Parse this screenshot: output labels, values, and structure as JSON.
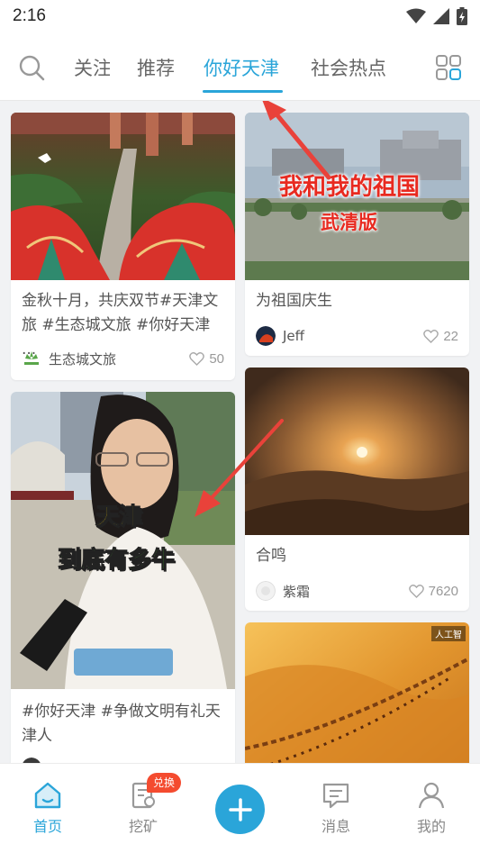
{
  "status_bar": {
    "time": "2:16"
  },
  "top_nav": {
    "tabs": [
      {
        "label": "关注"
      },
      {
        "label": "推荐"
      },
      {
        "label": "你好天津"
      },
      {
        "label": "社会热点"
      }
    ],
    "active_tab": "你好天津"
  },
  "feed": {
    "cards": [
      {
        "title": "金秋十月，共庆双节#天津文旅 #生态城文旅 #你好天津 ...",
        "author": "生态城文旅",
        "likes": "50"
      },
      {
        "title": "为祖国庆生",
        "author": "Jeff",
        "likes": "22",
        "overlay": {
          "line1": "我和我的祖国",
          "line2": "武清版"
        }
      },
      {
        "title": "#你好天津 #争做文明有礼天津人",
        "author": "",
        "likes": "",
        "overlay": {
          "line1": "天津",
          "line2": "到底有多牛"
        }
      },
      {
        "title": "合鸣",
        "author": "紫霜",
        "likes": "7620"
      },
      {
        "title": "",
        "author": "",
        "likes": "",
        "overlay": {
          "line1": "人工智"
        }
      }
    ]
  },
  "bottom_nav": {
    "items": [
      {
        "label": "首页"
      },
      {
        "label": "挖矿"
      },
      {
        "label": "消息"
      },
      {
        "label": "我的"
      }
    ],
    "badge": "兑换"
  },
  "colors": {
    "accent": "#2aa5d9",
    "badge": "#f44b2f"
  },
  "icons": [
    "search-icon",
    "grid-icon",
    "heart-icon",
    "home-icon",
    "mining-icon",
    "plus-icon",
    "message-icon",
    "profile-icon",
    "wifi-icon",
    "signal-icon",
    "battery-icon"
  ]
}
